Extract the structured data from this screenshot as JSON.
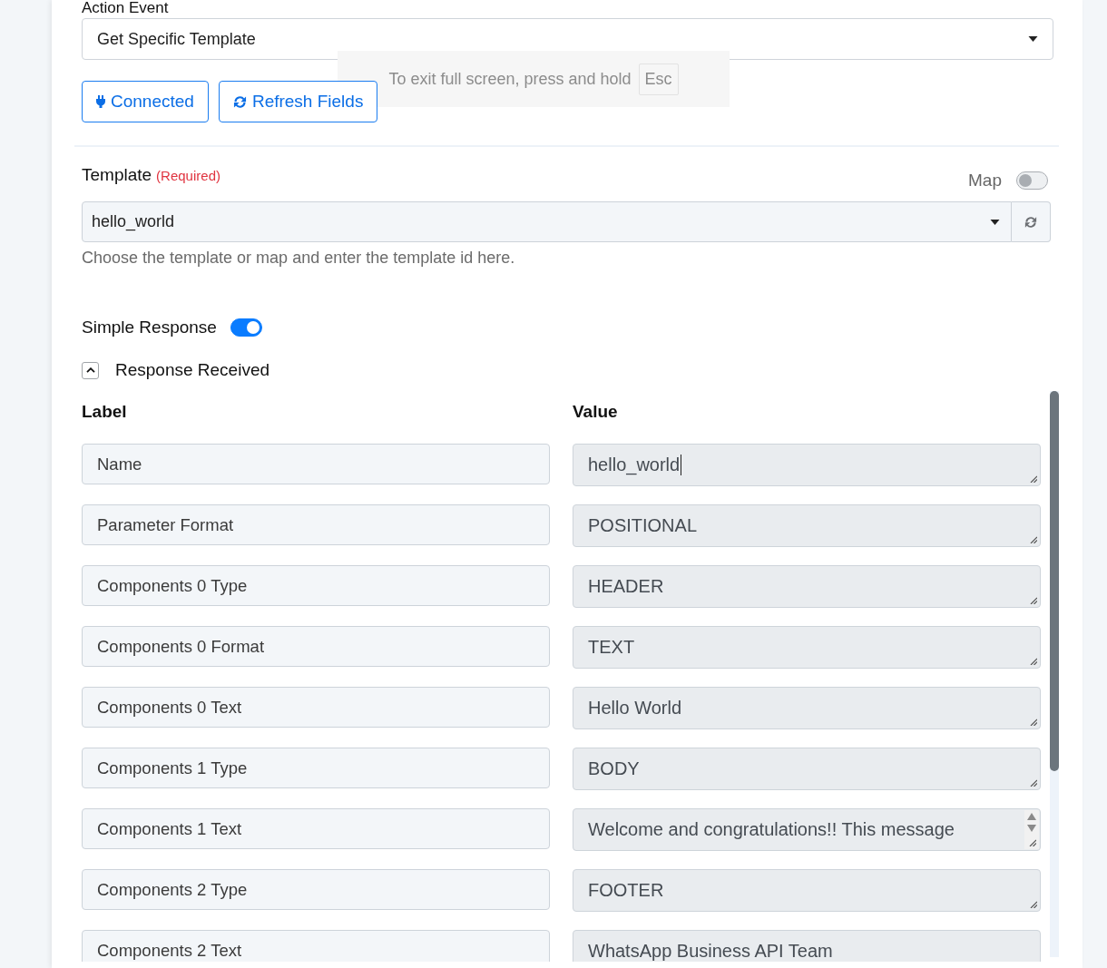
{
  "action_event": {
    "label": "Action Event",
    "value": "Get Specific Template"
  },
  "buttons": [
    {
      "kind": "connected",
      "label": "Connected"
    },
    {
      "kind": "refresh",
      "label": "Refresh Fields"
    }
  ],
  "fullscreen_notice": {
    "text": "To exit full screen, press and hold",
    "key": "Esc"
  },
  "template": {
    "label": "Template",
    "required": "(Required)",
    "map_label": "Map",
    "map_on": false,
    "value": "hello_world",
    "help": "Choose the template or map and enter the template id here."
  },
  "simple_response": {
    "label": "Simple Response",
    "on": true
  },
  "response_received": {
    "label": "Response Received",
    "expanded": true
  },
  "fields_table": {
    "columns": [
      "Label",
      "Value"
    ],
    "rows": [
      {
        "label": "Name",
        "value": "hello_world",
        "focused": true,
        "overflow": false
      },
      {
        "label": "Parameter Format",
        "value": "POSITIONAL",
        "focused": false,
        "overflow": false
      },
      {
        "label": "Components 0 Type",
        "value": "HEADER",
        "focused": false,
        "overflow": false
      },
      {
        "label": "Components 0 Format",
        "value": "TEXT",
        "focused": false,
        "overflow": false
      },
      {
        "label": "Components 0 Text",
        "value": "Hello World",
        "focused": false,
        "overflow": false
      },
      {
        "label": "Components 1 Type",
        "value": "BODY",
        "focused": false,
        "overflow": false
      },
      {
        "label": "Components 1 Text",
        "value": "Welcome and congratulations!! This message",
        "focused": false,
        "overflow": true
      },
      {
        "label": "Components 2 Type",
        "value": "FOOTER",
        "focused": false,
        "overflow": false
      },
      {
        "label": "Components 2 Text",
        "value": "WhatsApp Business API Team",
        "focused": false,
        "overflow": false
      }
    ]
  }
}
